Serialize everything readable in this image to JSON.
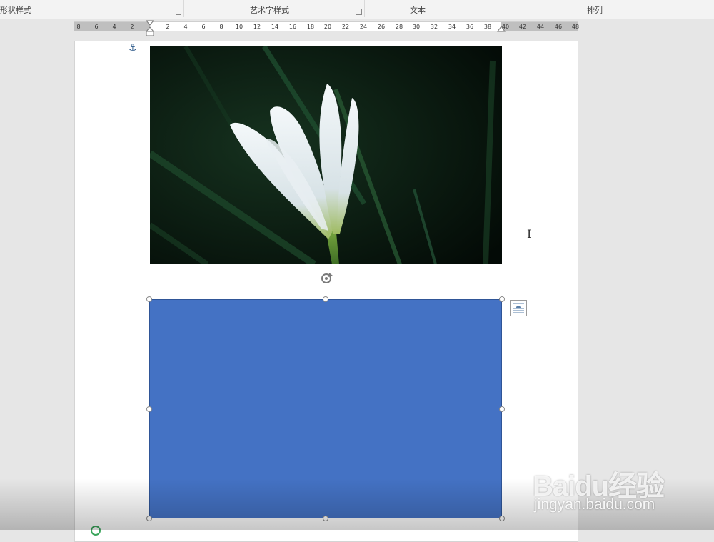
{
  "ribbon": {
    "groups": [
      {
        "label": "形状样式"
      },
      {
        "label": "艺术字样式"
      },
      {
        "label": "文本"
      },
      {
        "label": "排列"
      }
    ]
  },
  "ruler": {
    "labels": [
      "8",
      "6",
      "4",
      "2",
      "2",
      "4",
      "6",
      "8",
      "10",
      "12",
      "14",
      "16",
      "18",
      "20",
      "22",
      "24",
      "26",
      "28",
      "30",
      "32",
      "34",
      "36",
      "38",
      "40",
      "42",
      "44",
      "46",
      "48"
    ]
  },
  "document": {
    "image": {
      "icon": "flower-photo"
    },
    "shape": {
      "fill": "#4472c4",
      "type": "rectangle"
    }
  },
  "watermark": {
    "logo": "Baidu经验",
    "url": "jingyan.baidu.com"
  }
}
